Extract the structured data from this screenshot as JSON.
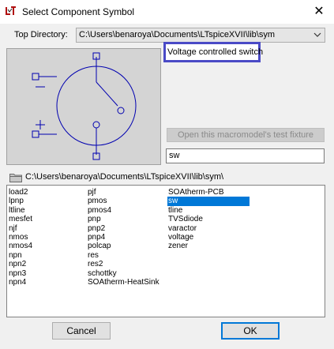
{
  "window": {
    "title": "Select Component Symbol",
    "close_icon": "close-icon",
    "app_icon": "ltspice-icon"
  },
  "top_directory": {
    "label": "Top Directory:",
    "value": "C:\\Users\\benaroya\\Documents\\LTspiceXVII\\lib\\sym",
    "dropdown_icon": "chevron-down-icon"
  },
  "preview": {
    "symbol": "sw",
    "description": "Voltage controlled switch",
    "line_color": "#0000b0"
  },
  "macro_button": {
    "label": "Open this macromodel's test fixture",
    "enabled": false
  },
  "search": {
    "value": "sw"
  },
  "path": {
    "icon": "folder-icon",
    "label": "C:\\Users\\benaroya\\Documents\\LTspiceXVII\\lib\\sym\\"
  },
  "component_list": {
    "selected": "sw",
    "columns": [
      [
        "load2",
        "lpnp",
        "ltline",
        "mesfet",
        "njf",
        "nmos",
        "nmos4",
        "npn",
        "npn2",
        "npn3",
        "npn4"
      ],
      [
        "pjf",
        "pmos",
        "pmos4",
        "pnp",
        "pnp2",
        "pnp4",
        "polcap",
        "res",
        "res2",
        "schottky",
        "SOAtherm-HeatSink"
      ],
      [
        "SOAtherm-PCB",
        "sw",
        "tline",
        "TVSdiode",
        "varactor",
        "voltage",
        "zener"
      ]
    ]
  },
  "buttons": {
    "cancel": "Cancel",
    "ok": "OK"
  },
  "colors": {
    "selection": "#0078d7",
    "highlight_border": "#4a4ac6"
  }
}
